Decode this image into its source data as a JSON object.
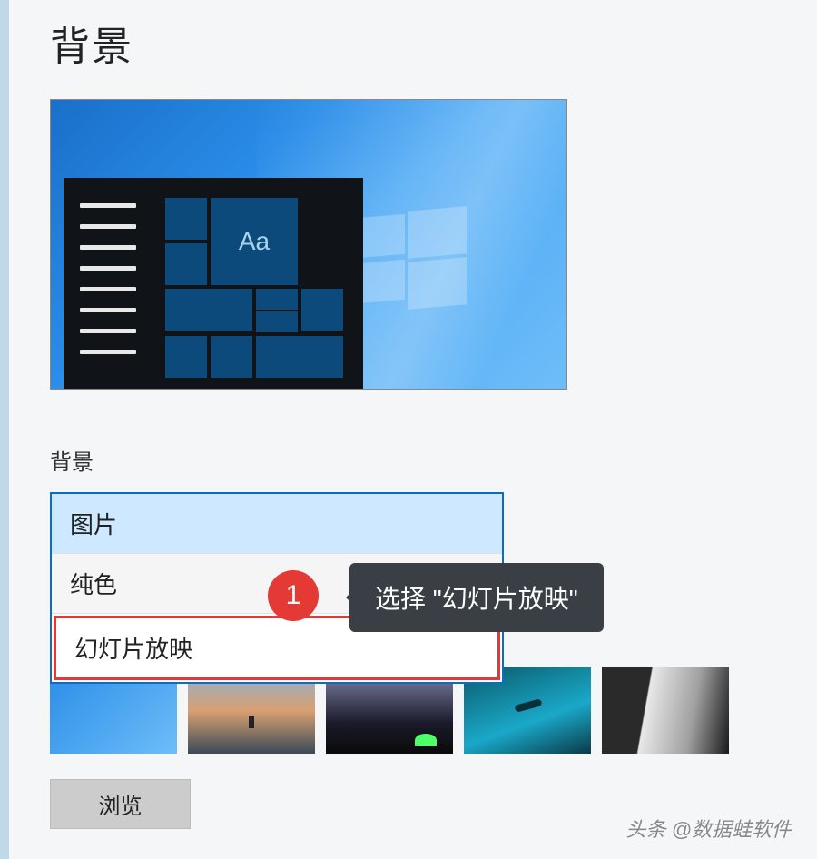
{
  "page": {
    "title": "背景"
  },
  "preview": {
    "sample_text": "Aa"
  },
  "background_section": {
    "label": "背景",
    "dropdown": [
      {
        "label": "图片",
        "state": "selected"
      },
      {
        "label": "纯色",
        "state": "hover"
      },
      {
        "label": "幻灯片放映",
        "state": "highlight"
      }
    ]
  },
  "callout": {
    "step_number": "1",
    "tooltip_text": "选择 \"幻灯片放映\""
  },
  "thumbnails": {
    "count": 5
  },
  "buttons": {
    "browse": "浏览"
  },
  "watermark": {
    "prefix": "头条",
    "handle": "@数据蛙软件"
  }
}
